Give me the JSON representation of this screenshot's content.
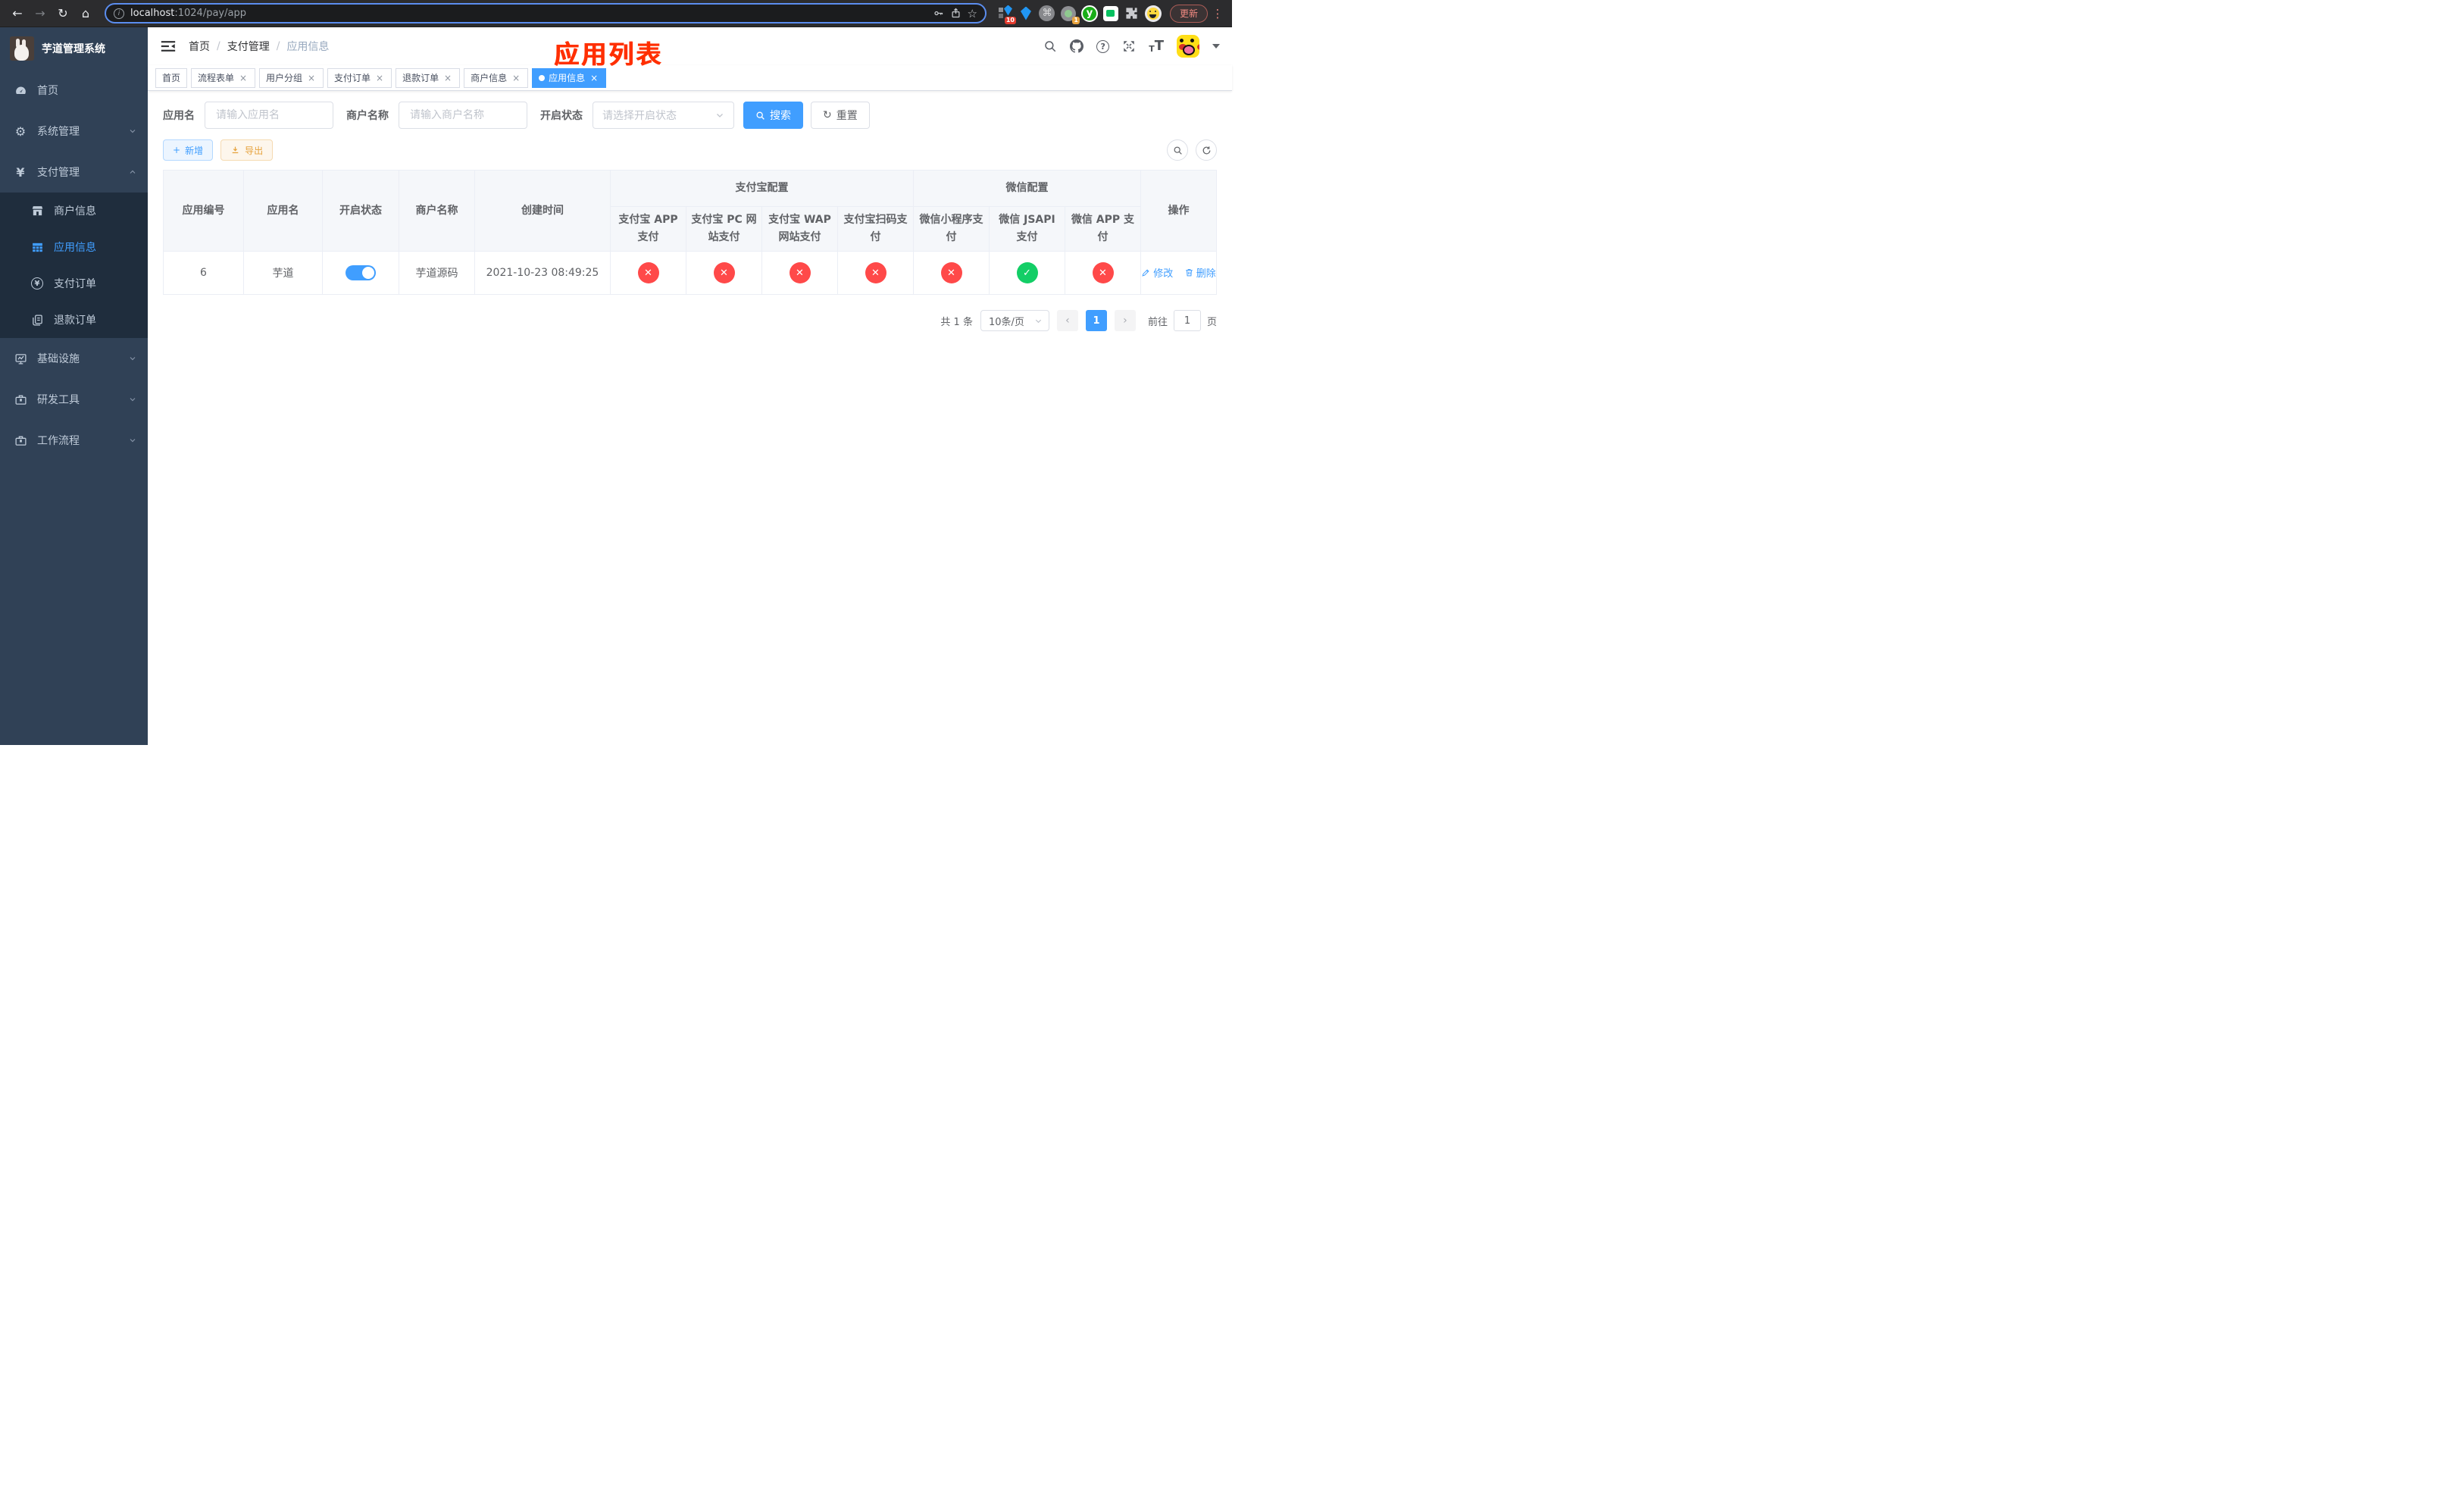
{
  "browser": {
    "url_host": "localhost",
    "url_rest": ":1024/pay/app",
    "update_label": "更新",
    "ext_badge_blocks": "10",
    "ext_badge_ring": "1",
    "ext_y_label": "y"
  },
  "icons": {
    "back": "←",
    "forward": "→",
    "reload": "↻",
    "home": "⌂",
    "info": "i",
    "star": "☆",
    "command": "⌘",
    "kebab": "⋮",
    "question": "?",
    "t_small": "T",
    "t_large": "T",
    "gear": "⚙",
    "yen": "¥",
    "close": "×",
    "check": "✓",
    "cross": "✕",
    "refresh_glyph": "↻",
    "plus": "+",
    "prev": "‹",
    "next": "›"
  },
  "colors": {
    "primary": "#409eff",
    "success": "#13ce66",
    "danger": "#ff4949",
    "warning": "#e6a23c",
    "sidebar_bg": "#304156",
    "submenu_bg": "#1f2d3d",
    "overlay_title": "#ff2f00"
  },
  "sidebar": {
    "title": "芋道管理系统",
    "items": [
      {
        "label": "首页"
      },
      {
        "label": "系统管理"
      },
      {
        "label": "支付管理"
      },
      {
        "label": "基础设施"
      },
      {
        "label": "研发工具"
      },
      {
        "label": "工作流程"
      }
    ],
    "sub_items": [
      {
        "label": "商户信息"
      },
      {
        "label": "应用信息"
      },
      {
        "label": "支付订单"
      },
      {
        "label": "退款订单"
      }
    ]
  },
  "header": {
    "breadcrumb": {
      "items": [
        "首页",
        "支付管理",
        "应用信息"
      ],
      "separator": "/"
    },
    "overlay_title": "应用列表"
  },
  "tabs": [
    {
      "label": "首页"
    },
    {
      "label": "流程表单"
    },
    {
      "label": "用户分组"
    },
    {
      "label": "支付订单"
    },
    {
      "label": "退款订单"
    },
    {
      "label": "商户信息"
    },
    {
      "label": "应用信息"
    }
  ],
  "filters": {
    "app_name_label": "应用名",
    "app_name_placeholder": "请输入应用名",
    "merchant_label": "商户名称",
    "merchant_placeholder": "请输入商户名称",
    "status_label": "开启状态",
    "status_placeholder": "请选择开启状态",
    "search_label": "搜索",
    "reset_label": "重置"
  },
  "toolbar": {
    "add_label": "新增",
    "export_label": "导出"
  },
  "table": {
    "columns": {
      "id": "应用编号",
      "name": "应用名",
      "enabled": "开启状态",
      "merchant": "商户名称",
      "created": "创建时间",
      "op": "操作",
      "alipay_group": "支付宝配置",
      "wechat_group": "微信配置",
      "sub": [
        "支付宝 APP 支付",
        "支付宝 PC 网站支付",
        "支付宝 WAP 网站支付",
        "支付宝扫码支付",
        "微信小程序支付",
        "微信 JSAPI 支付",
        "微信 APP 支付"
      ]
    },
    "rows": [
      {
        "id": "6",
        "name": "芋道",
        "enabled": true,
        "merchant": "芋道源码",
        "created": "2021-10-23 08:49:25",
        "statuses": [
          false,
          false,
          false,
          false,
          false,
          true,
          false
        ],
        "edit_label": "修改",
        "delete_label": "删除"
      }
    ]
  },
  "pagination": {
    "total": "共 1 条",
    "page_size": "10条/页",
    "current": "1",
    "goto_label": "前往",
    "goto_value": "1",
    "unit_label": "页"
  }
}
